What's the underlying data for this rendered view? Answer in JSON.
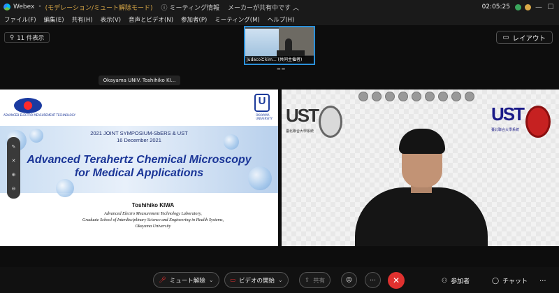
{
  "titlebar": {
    "app_name": "Webex",
    "mode": "(モデレーション/ミュート解除モード)",
    "meeting_info": "ミーティング情報",
    "speaker_label": "メーカーが共有中です",
    "clock": "02:05:25",
    "pill_colors": [
      "#3aa65c",
      "#d9a847"
    ]
  },
  "menu": [
    "ファイル(F)",
    "編集(E)",
    "共有(H)",
    "表示(V)",
    "音声とビデオ(N)",
    "参加者(P)",
    "ミーティング(M)",
    "ヘルプ(H)"
  ],
  "participants_button": "11 件表示",
  "layout_button": "レイアウト",
  "thumbnail": {
    "caption": "Judacoとkim... (共同主催者)"
  },
  "name_tag": "Okayama UNIV. Toshihiko KI...",
  "slide": {
    "symposium": "2021 JOINT SYMPOSIUM-SbERS & UST",
    "date": "16 December 2021",
    "title_line1": "Advanced Terahertz Chemical Microscopy",
    "title_line2": "for Medical Applications",
    "author": "Toshihiko KIWA",
    "affiliations": [
      "Advanced Electro Measurement Technology Laboratory,",
      "Graduate School of Interdisciplinary Science and Engineering in Health Systems,",
      "Okayama University"
    ],
    "right_logo": "U"
  },
  "annotation_tools": [
    "✎",
    "✕",
    "⊕",
    "⊖"
  ],
  "video": {
    "lst_text": "UST",
    "lst_caption": "臺北聯合大學系統"
  },
  "controls": {
    "mute": "ミュート解除",
    "video": "ビデオの開始",
    "share": "共有",
    "participants": "参加者",
    "chat": "チャット",
    "more": "..."
  }
}
